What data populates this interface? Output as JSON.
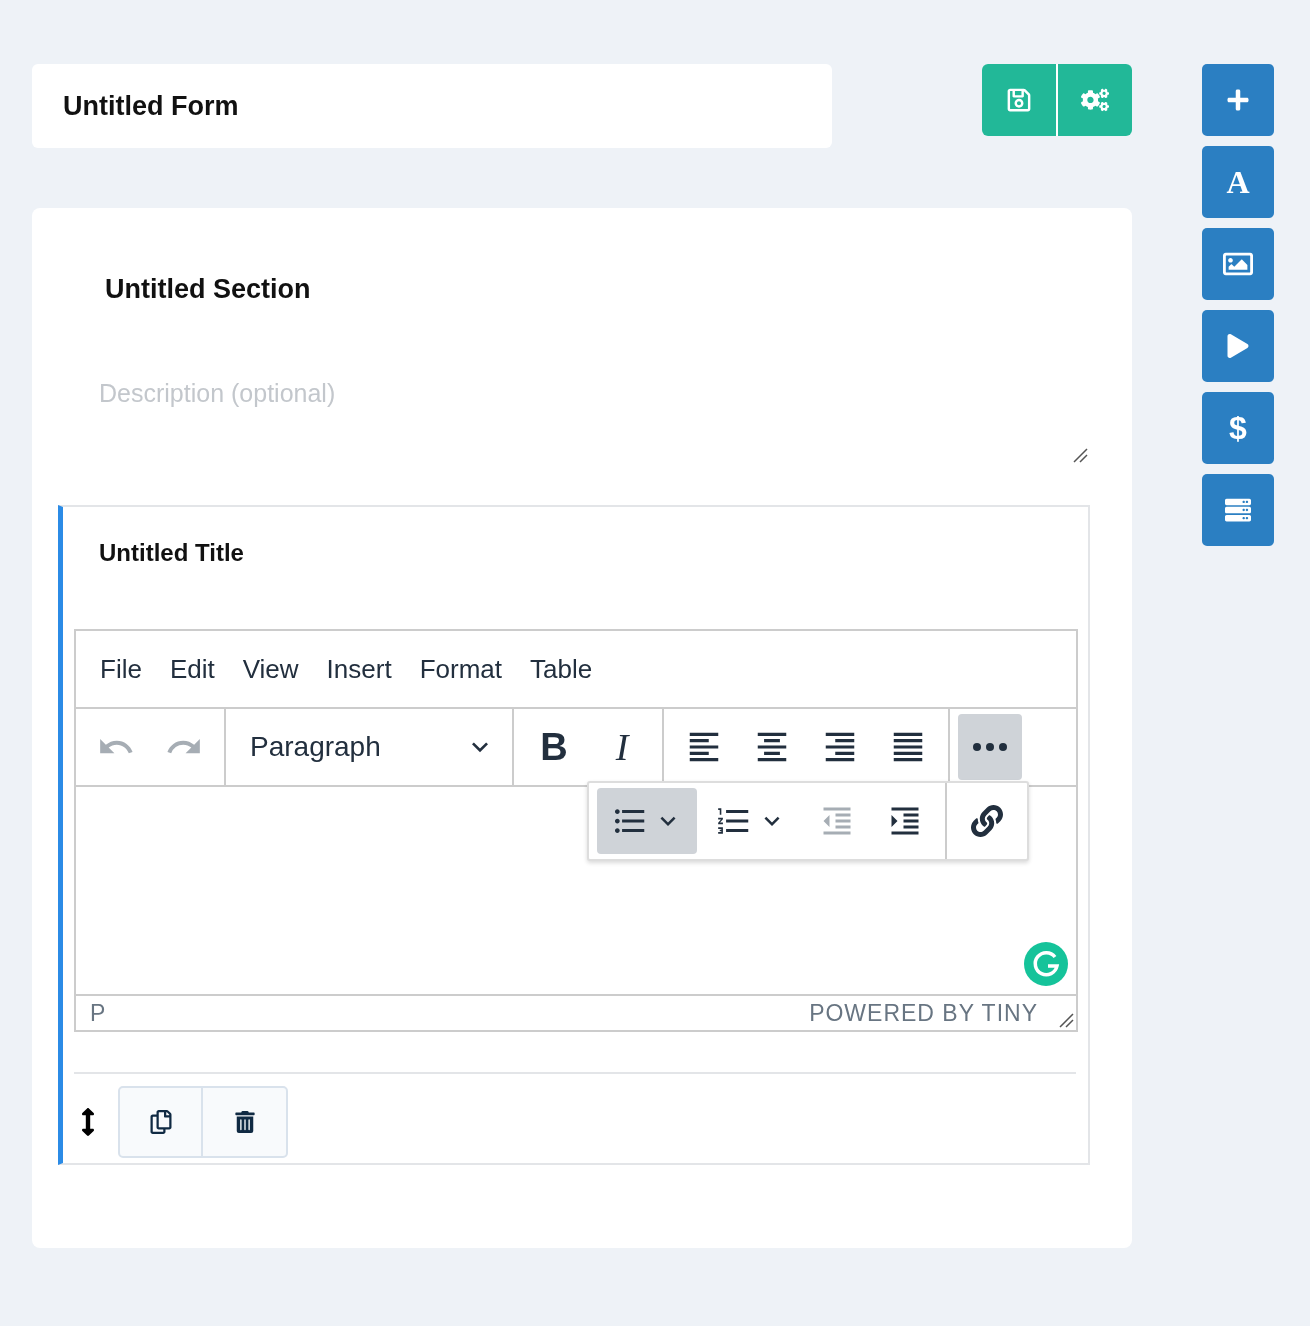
{
  "form": {
    "title": "Untitled Form"
  },
  "header_buttons": [
    {
      "kind": "save"
    },
    {
      "kind": "settings"
    }
  ],
  "side_tools": [
    {
      "kind": "add"
    },
    {
      "kind": "text",
      "glyph": "A"
    },
    {
      "kind": "image"
    },
    {
      "kind": "video"
    },
    {
      "kind": "price",
      "glyph": "$"
    },
    {
      "kind": "list"
    }
  ],
  "section": {
    "title": "Untitled Section",
    "description": {
      "placeholder": "Description (optional)"
    }
  },
  "question": {
    "title": "Untitled Title",
    "editor": {
      "menu": [
        "File",
        "Edit",
        "View",
        "Insert",
        "Format",
        "Table"
      ],
      "history": [
        {
          "kind": "undo",
          "disabled": true
        },
        {
          "kind": "redo",
          "disabled": true
        }
      ],
      "block_format": "Paragraph",
      "styles": [
        {
          "kind": "bold",
          "glyph": "B"
        },
        {
          "kind": "italic",
          "glyph": "I"
        }
      ],
      "align": [
        {
          "kind": "left"
        },
        {
          "kind": "center"
        },
        {
          "kind": "right"
        },
        {
          "kind": "justify"
        }
      ],
      "more": {
        "expanded": true
      },
      "overflow": [
        {
          "kind": "bullet-list",
          "selected": true
        },
        {
          "kind": "numbered-list",
          "selected": false
        },
        {
          "kind": "outdent",
          "disabled": true
        },
        {
          "kind": "indent",
          "disabled": false
        },
        {
          "kind": "link",
          "disabled": false
        }
      ],
      "status_path": "P",
      "branding": "POWERED BY TINY"
    }
  },
  "actions": [
    {
      "kind": "duplicate"
    },
    {
      "kind": "delete"
    }
  ]
}
